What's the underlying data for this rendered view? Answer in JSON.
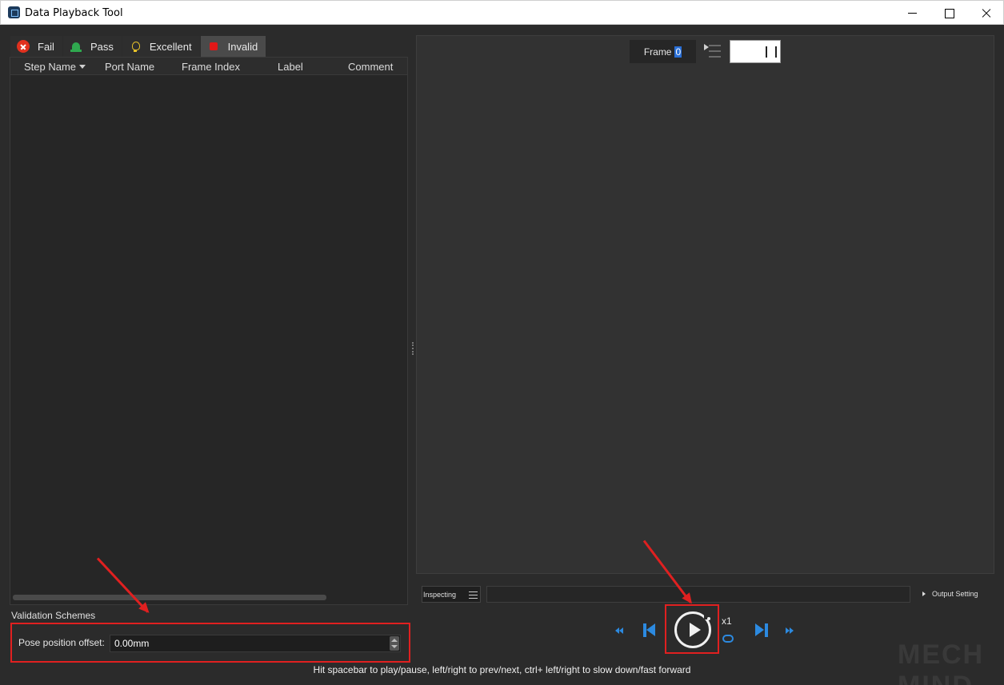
{
  "window": {
    "title": "Data Playback Tool"
  },
  "tabs": [
    {
      "label": "Fail",
      "icon": "fail-icon",
      "active": false
    },
    {
      "label": "Pass",
      "icon": "pass-icon",
      "active": false
    },
    {
      "label": "Excellent",
      "icon": "excellent-icon",
      "active": false
    },
    {
      "label": "Invalid",
      "icon": "invalid-icon",
      "active": true
    }
  ],
  "table": {
    "columns": [
      "Step Name",
      "Port Name",
      "Frame Index",
      "Label",
      "Comment"
    ],
    "rows": []
  },
  "validation": {
    "title": "Validation Schemes",
    "offset_label": "Pose position offset:",
    "offset_value": "0.00mm"
  },
  "viewer": {
    "frame_label": "Frame",
    "frame_value": "0"
  },
  "controls": {
    "inspecting_label": "Inspecting",
    "output_setting_label": "Output Setting",
    "speed": "x1",
    "hint": "Hit spacebar to play/pause, left/right to prev/next, ctrl+ left/right to slow down/fast forward"
  },
  "watermark": "MECH MIND",
  "colors": {
    "background": "#2b2b2b",
    "accent": "#2c8ae0",
    "highlight": "#e02020",
    "fail": "#e0301e",
    "pass": "#2fa84f",
    "excellent": "#e6c12a",
    "invalid": "#e01818"
  }
}
